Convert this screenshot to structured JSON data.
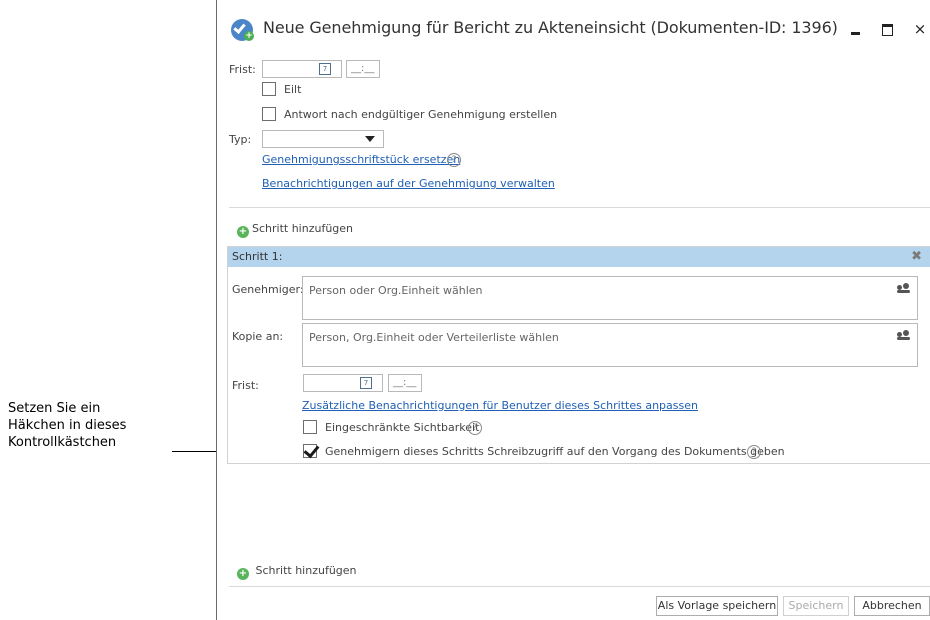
{
  "annotation": {
    "text_line1": "Setzen Sie ein",
    "text_line2": "Häkchen in dieses",
    "text_line3": "Kontrollkästchen"
  },
  "window": {
    "title": "Neue Genehmigung für Bericht zu Akteneinsicht (Dokumenten-ID: 1396)",
    "close_glyph": "×"
  },
  "form": {
    "frist_label": "Frist:",
    "time_placeholder": "__:__",
    "eilt_label": "Eilt",
    "eilt_checked": false,
    "antwort_label": "Antwort nach endgültiger Genehmigung erstellen",
    "antwort_checked": false,
    "typ_label": "Typ:",
    "typ_value": "",
    "link_replace": "Genehmigungsschriftstück ersetzen",
    "link_notifications": "Benachrichtigungen auf der Genehmigung verwalten",
    "help_glyph": "?"
  },
  "steps": {
    "add_step_top": "Schritt hinzufügen",
    "step1": {
      "header": "Schritt 1:",
      "approver_label": "Genehmiger:",
      "approver_placeholder": "Person oder Org.Einheit wählen",
      "copy_label": "Kopie an:",
      "copy_placeholder": "Person, Org.Einheit oder Verteilerliste wählen",
      "frist_label": "Frist:",
      "time_placeholder": "__:__",
      "link_notifications": "Zusätzliche Benachrichtigungen für Benutzer dieses Schrittes anpassen",
      "restricted_label": "Eingeschränkte Sichtbarkeit",
      "restricted_checked": false,
      "write_access_label": "Genehmigern dieses Schritts Schreibzugriff auf den Vorgang des Dokuments geben",
      "write_access_checked": true
    },
    "add_step_bottom": "Schritt hinzufügen"
  },
  "footer": {
    "save_template": "Als Vorlage speichern",
    "save": "Speichern",
    "cancel": "Abbrechen"
  },
  "colors": {
    "step_header_bg": "#b3d4ec",
    "link": "#1f5fb4",
    "add_icon": "#5ab45a"
  }
}
